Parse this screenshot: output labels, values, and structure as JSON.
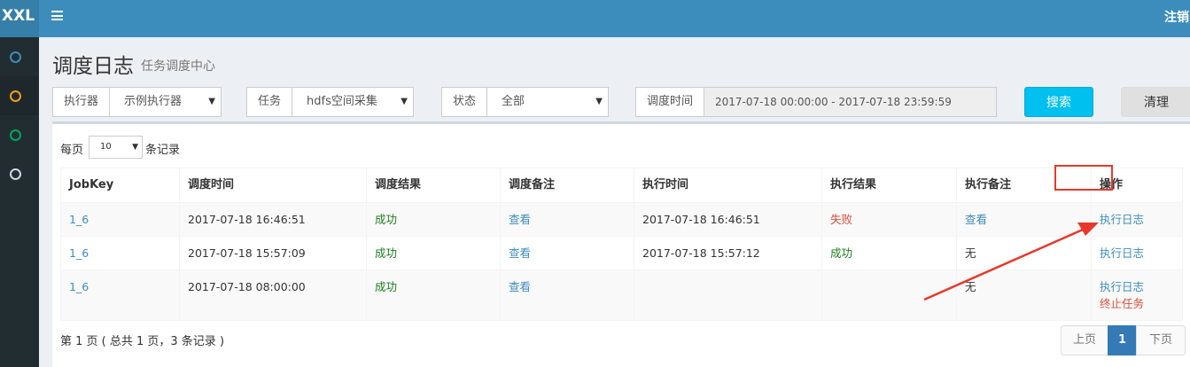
{
  "header": {
    "logo": "XXL",
    "logout_label": "注销"
  },
  "sidebar": {
    "items": [
      {
        "icon": "circle-icon",
        "color": "#3c8dbc"
      },
      {
        "icon": "circle-icon",
        "color": "#f39c12"
      },
      {
        "icon": "circle-icon",
        "color": "#00a65a"
      },
      {
        "icon": "circle-icon",
        "color": "#d2d6de"
      }
    ]
  },
  "page": {
    "title": "调度日志",
    "subtitle": "任务调度中心"
  },
  "filters": {
    "executor_label": "执行器",
    "executor_value": "示例执行器",
    "job_label": "任务",
    "job_value": "hdfs空间采集",
    "status_label": "状态",
    "status_value": "全部",
    "time_label": "调度时间",
    "time_value": "2017-07-18 00:00:00 - 2017-07-18 23:59:59",
    "search_label": "搜索",
    "clear_label": "清理"
  },
  "paging": {
    "prefix": "每页",
    "size": "10",
    "suffix": "条记录"
  },
  "table": {
    "headers": [
      "JobKey",
      "调度时间",
      "调度结果",
      "调度备注",
      "执行时间",
      "执行结果",
      "执行备注",
      "操作"
    ],
    "rows": [
      {
        "jobkey": "1_6",
        "trigger_time": "2017-07-18 16:46:51",
        "trigger_result": "成功",
        "trigger_msg": "查看",
        "handle_time": "2017-07-18 16:46:51",
        "handle_result": "失败",
        "handle_msg": "查看",
        "op1": "执行日志",
        "op2": ""
      },
      {
        "jobkey": "1_6",
        "trigger_time": "2017-07-18 15:57:09",
        "trigger_result": "成功",
        "trigger_msg": "查看",
        "handle_time": "2017-07-18 15:57:12",
        "handle_result": "成功",
        "handle_msg": "无",
        "op1": "执行日志",
        "op2": ""
      },
      {
        "jobkey": "1_6",
        "trigger_time": "2017-07-18 08:00:00",
        "trigger_result": "成功",
        "trigger_msg": "查看",
        "handle_time": "",
        "handle_result": "",
        "handle_msg": "无",
        "op1": "执行日志",
        "op2": "终止任务"
      }
    ]
  },
  "footer": {
    "info": "第 1 页 ( 总共 1 页，3 条记录 )",
    "prev": "上页",
    "current": "1",
    "next": "下页"
  },
  "colors": {
    "header": "#3c8dbc",
    "sidebar": "#222d32",
    "search_button": "#00c0ef",
    "success": "#1a7d1a",
    "fail": "#dd4b39",
    "annotation": "#e8382b"
  }
}
